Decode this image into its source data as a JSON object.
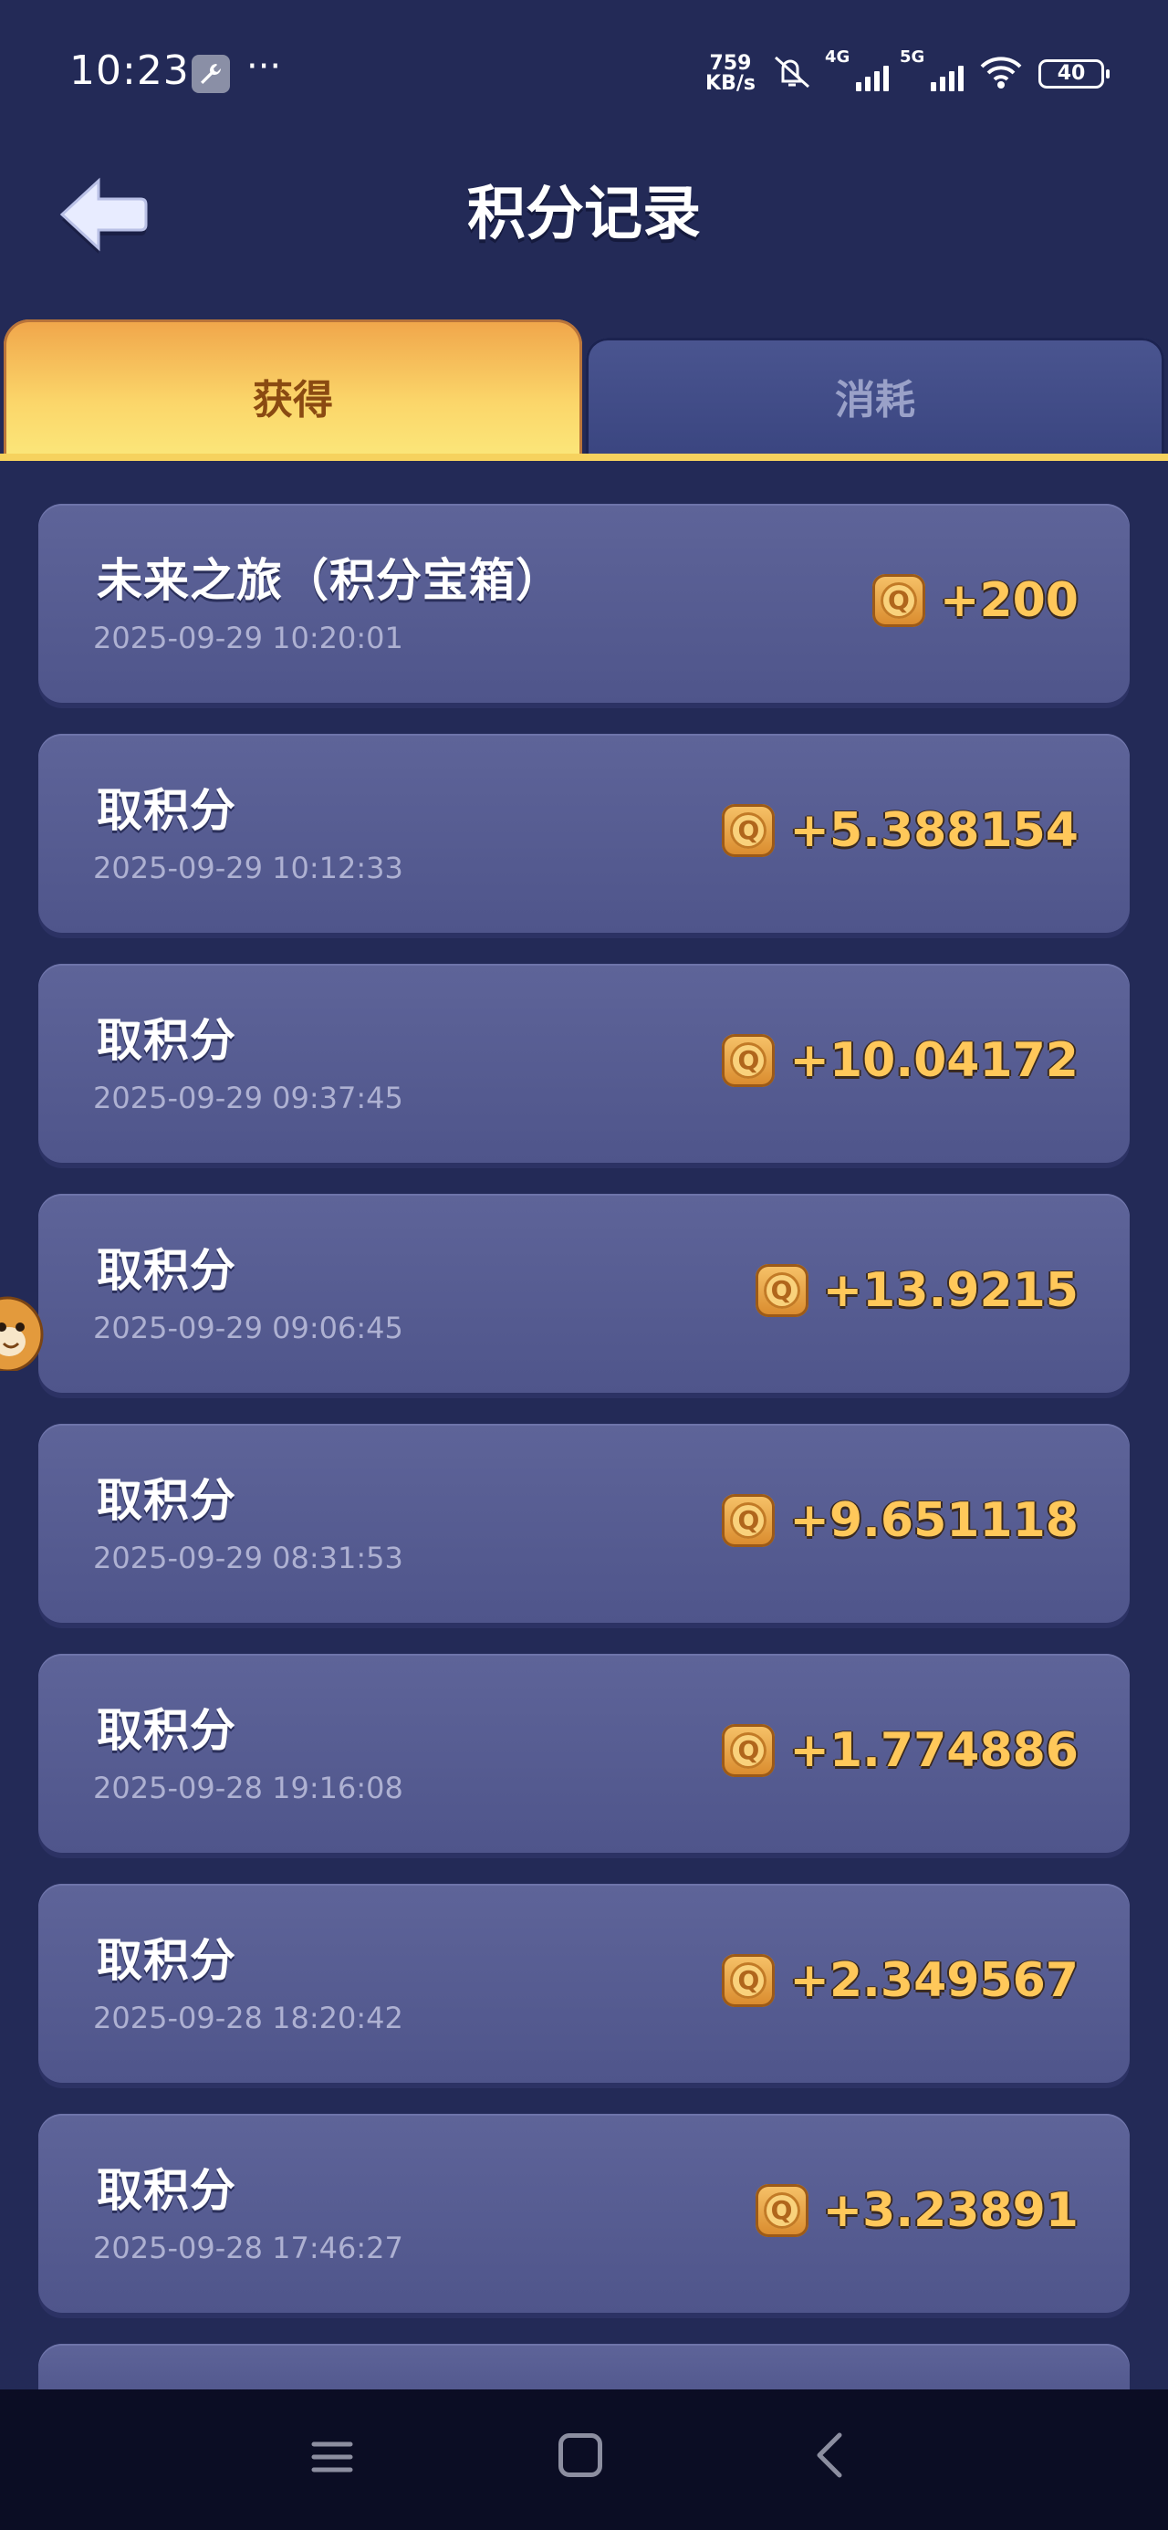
{
  "status_bar": {
    "time": "10:23",
    "dots": "···",
    "net_speed_value": "759",
    "net_speed_unit": "KB/s",
    "sim1_label": "4G",
    "sim2_label": "5G",
    "battery": "40"
  },
  "header": {
    "title": "积分记录",
    "back_icon": "back-arrow-icon"
  },
  "tabs": {
    "active": "获得",
    "inactive": "消耗"
  },
  "records": [
    {
      "title": "未来之旅（积分宝箱）",
      "time": "2025-09-29 10:20:01",
      "amount": "+200"
    },
    {
      "title": "取积分",
      "time": "2025-09-29 10:12:33",
      "amount": "+5.388154"
    },
    {
      "title": "取积分",
      "time": "2025-09-29 09:37:45",
      "amount": "+10.04172"
    },
    {
      "title": "取积分",
      "time": "2025-09-29 09:06:45",
      "amount": "+13.9215"
    },
    {
      "title": "取积分",
      "time": "2025-09-29 08:31:53",
      "amount": "+9.651118"
    },
    {
      "title": "取积分",
      "time": "2025-09-28 19:16:08",
      "amount": "+1.774886"
    },
    {
      "title": "取积分",
      "time": "2025-09-28 18:20:42",
      "amount": "+2.349567"
    },
    {
      "title": "取积分",
      "time": "2025-09-28 17:46:27",
      "amount": "+3.23891"
    }
  ],
  "coin_glyph": "Q",
  "colors": {
    "background": "#232a57",
    "card": "#575d93",
    "amount": "#ffc85a",
    "tab_active": "#fbd66a"
  }
}
